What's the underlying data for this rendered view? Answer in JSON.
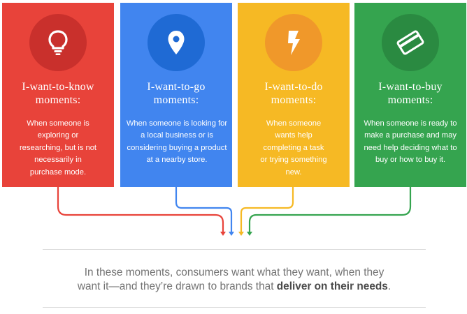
{
  "cards": [
    {
      "title_line1": "I-want-to-know",
      "title_line2": "moments:",
      "description": "When someone is exploring or researching, but is not necessarily in purchase mode.",
      "icon": "lightbulb-icon",
      "color": "#e8433a"
    },
    {
      "title_line1": "I-want-to-go",
      "title_line2": "moments:",
      "description": "When someone is looking for a local business or is considering buying a product at a nearby store.",
      "icon": "location-pin-icon",
      "color": "#4185ef"
    },
    {
      "title_line1": "I-want-to-do",
      "title_line2": "moments:",
      "description": "When someone wants help completing a task or trying something new.",
      "icon": "lightning-bolt-icon",
      "color": "#f6b924"
    },
    {
      "title_line1": "I-want-to-buy",
      "title_line2": "moments:",
      "description": "When someone is ready to make a purchase and may need help deciding what to buy or how to buy it.",
      "icon": "credit-card-icon",
      "color": "#35a44f"
    }
  ],
  "caption": {
    "line1": "In these moments, consumers want what they want, when they",
    "line2_prefix": "want it—and they’re drawn to brands that ",
    "line2_bold": "deliver on their needs",
    "line2_suffix": "."
  }
}
